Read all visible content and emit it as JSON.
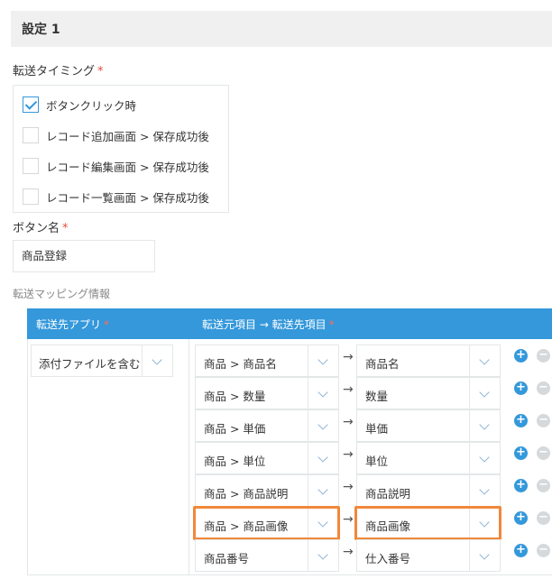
{
  "section": {
    "title": "設定 1"
  },
  "timing": {
    "label": "転送タイミング",
    "required": "*",
    "options": [
      {
        "label": "ボタンクリック時",
        "checked": true
      },
      {
        "label": "レコード追加画面 > 保存成功後",
        "checked": false
      },
      {
        "label": "レコード編集画面 > 保存成功後",
        "checked": false
      },
      {
        "label": "レコード一覧画面 > 保存成功後",
        "checked": false
      }
    ]
  },
  "button_name": {
    "label": "ボタン名",
    "required": "*",
    "value": "商品登録"
  },
  "mapping": {
    "label": "転送マッピング情報",
    "header": {
      "dest_app": "転送先アプリ",
      "required": "*",
      "fields": "転送元項目 → 転送先項目"
    },
    "dest_app_value": "添付ファイルを含む",
    "arrow": "→",
    "rows": [
      {
        "source": "商品 > 商品名",
        "target": "商品名",
        "highlighted": false
      },
      {
        "source": "商品 > 数量",
        "target": "数量",
        "highlighted": false
      },
      {
        "source": "商品 > 単価",
        "target": "単価",
        "highlighted": false
      },
      {
        "source": "商品 > 単位",
        "target": "単位",
        "highlighted": false
      },
      {
        "source": "商品 > 商品説明",
        "target": "商品説明",
        "highlighted": false
      },
      {
        "source": "商品 > 商品画像",
        "target": "商品画像",
        "highlighted": true
      },
      {
        "source": "商品番号",
        "target": "仕入番号",
        "highlighted": false
      }
    ],
    "add_symbol": "+",
    "remove_symbol": "−"
  },
  "colors": {
    "accent": "#3498db",
    "required": "#e74c3c",
    "highlight": "#f0883a"
  }
}
